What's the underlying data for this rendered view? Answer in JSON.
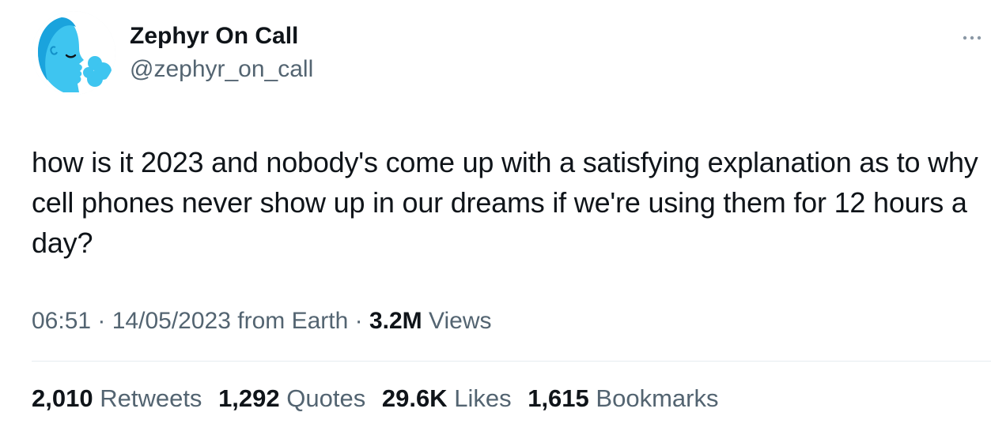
{
  "author": {
    "display_name": "Zephyr On Call",
    "handle": "@zephyr_on_call",
    "avatar_icon": "profile-avatar-blue-face-icon"
  },
  "tweet": {
    "text": "how is it 2023 and nobody's come up with a satisfying explanation as to why cell phones never show up in our dreams if we're using them for 12 hours a day?",
    "time": "06:51",
    "date": "14/05/2023",
    "source": "from Earth",
    "separator": " · ",
    "views_count": "3.2M",
    "views_label": "Views"
  },
  "stats": [
    {
      "count": "2,010",
      "label": "Retweets"
    },
    {
      "count": "1,292",
      "label": "Quotes"
    },
    {
      "count": "29.6K",
      "label": "Likes"
    },
    {
      "count": "1,615",
      "label": "Bookmarks"
    }
  ],
  "colors": {
    "text_primary": "#0f1419",
    "text_secondary": "#536471",
    "divider": "#e6ecf0",
    "avatar_blue": "#39c6f2"
  },
  "more_icon": "more-dots-icon"
}
